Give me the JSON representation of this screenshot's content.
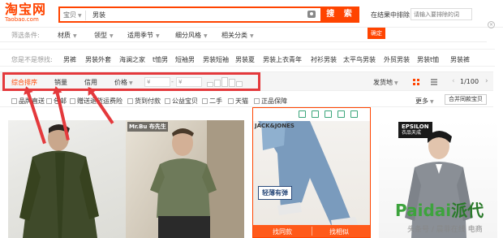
{
  "header": {
    "logo_main": "淘宝网",
    "logo_sub": "Taobao.com",
    "search_type": "宝贝",
    "search_query": "男装",
    "search_button": "搜 索",
    "exclude_label": "在结果中排除",
    "exclude_placeholder": "请输入要排除的词",
    "camera_icon": "camera-icon"
  },
  "filters": {
    "label": "筛选条件:",
    "items": [
      "材质",
      "领型",
      "适用季节",
      "细分风格",
      "相关分类"
    ],
    "confirm": "确定"
  },
  "related": {
    "label": "您是不是想找:",
    "items": [
      "男裤",
      "男装外套",
      "海澜之家",
      "t恤男",
      "短袖男",
      "男装短袖",
      "男装夏",
      "男装上衣青年",
      "衬衫男装",
      "太平鸟男装",
      "外贸男装",
      "男装t恤",
      "男装裤"
    ]
  },
  "sortbar": {
    "tabs": [
      "综合排序",
      "销量",
      "信用",
      "价格"
    ],
    "price_from": "¥",
    "price_to": "¥",
    "ship_label": "发货地",
    "page": "1/100"
  },
  "options": {
    "items": [
      "品牌直送",
      "包邮",
      "赠送退货运费险",
      "货到付款",
      "公益宝贝",
      "二手",
      "天猫",
      "正品保障"
    ],
    "more": "更多",
    "merge": "合并同款宝贝"
  },
  "products": {
    "p2_brand": "Mr.Bu 布先生",
    "p3_brand": "JACK&JONES",
    "p3_banner": "轻薄有弹",
    "p3_find_same": "找同款",
    "p3_find_similar": "找相似",
    "p4_brand": "EPSILON",
    "p4_brand_sub": "衣品天成"
  },
  "watermark": {
    "main_latin": "Paidai",
    "main_han": "派代",
    "sub": "头条号 / 晨菲在线 电商"
  },
  "colors": {
    "accent": "#ff4400",
    "annotation": "#e4393c"
  }
}
